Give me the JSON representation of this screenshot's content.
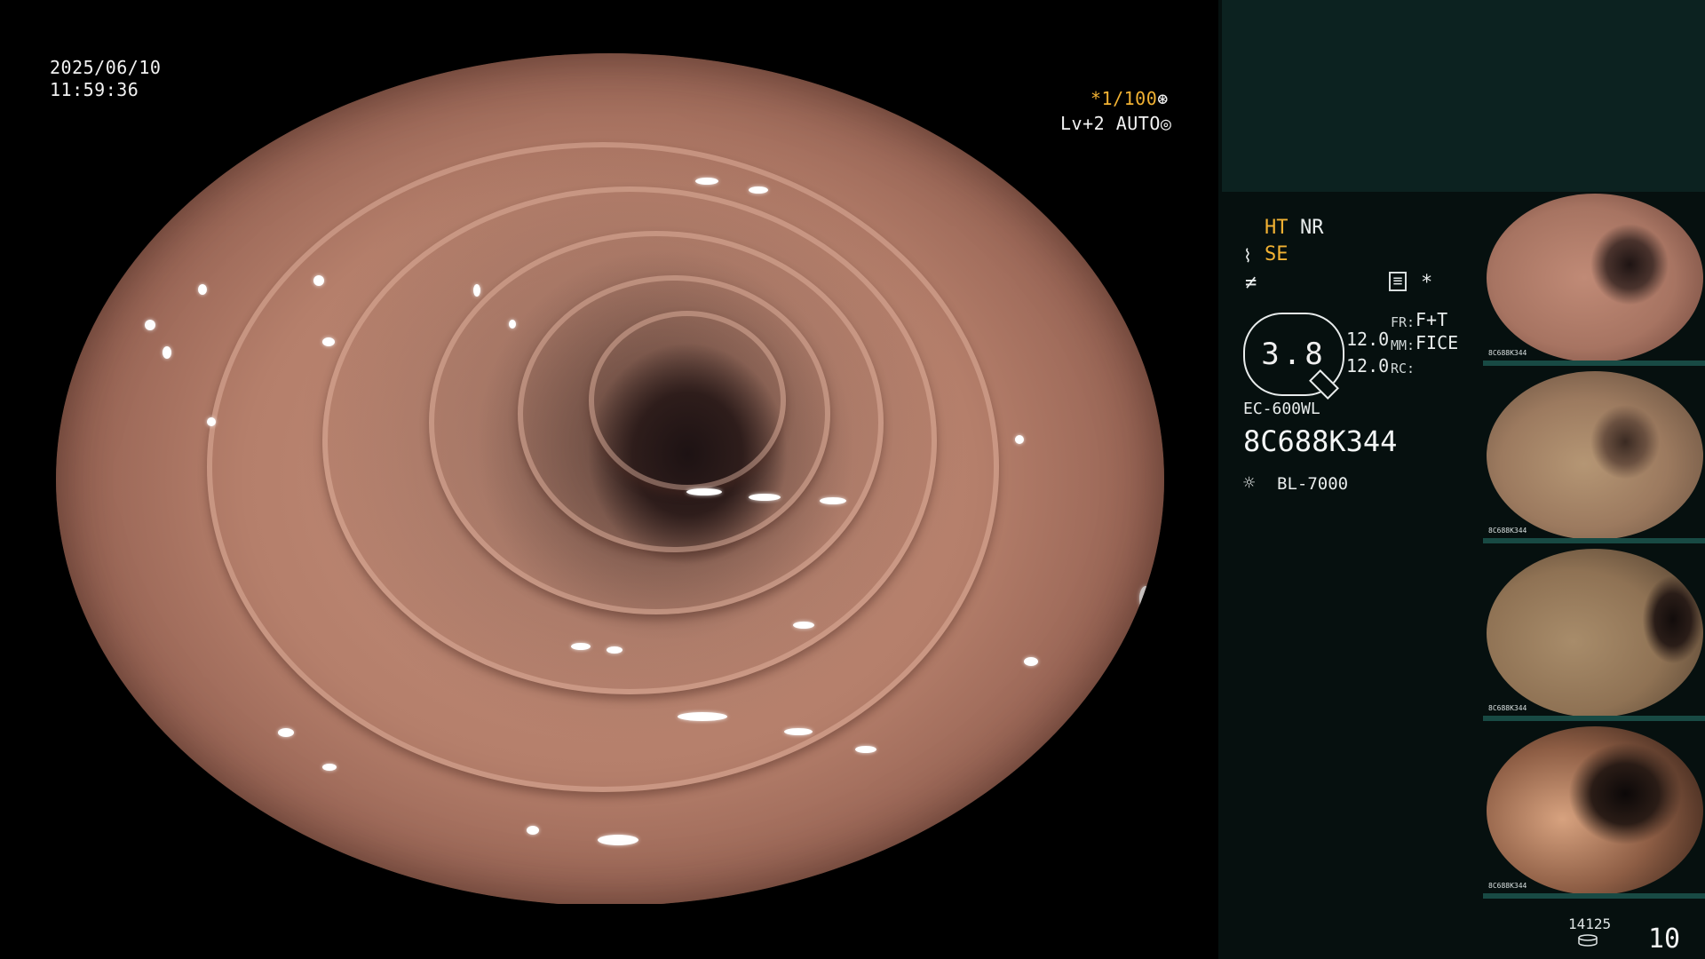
{
  "overlay": {
    "date": "2025/06/10",
    "time": "11:59:36",
    "exposure": "*1/100",
    "level": "Lv+2 AUTO"
  },
  "panel": {
    "ht": "HT",
    "nr": "NR",
    "se": "SE",
    "gauge_value": "3.8",
    "readout_1": "12.0",
    "readout_2": "12.0",
    "fr_label": "FR:",
    "fr_value": "F+T",
    "mm_label": "MM:",
    "mm_value": "FICE",
    "rc_label": "RC:",
    "scope_model": "EC-600WL",
    "scope_serial": "8C688K344",
    "light_source": "BL-7000",
    "asterisk": "*"
  },
  "thumbnails": [
    {
      "tag": "8C688K344"
    },
    {
      "tag": "8C688K344"
    },
    {
      "tag": "8C688K344"
    },
    {
      "tag": "8C688K344"
    }
  ],
  "footer": {
    "count": "14125",
    "page": "10"
  }
}
